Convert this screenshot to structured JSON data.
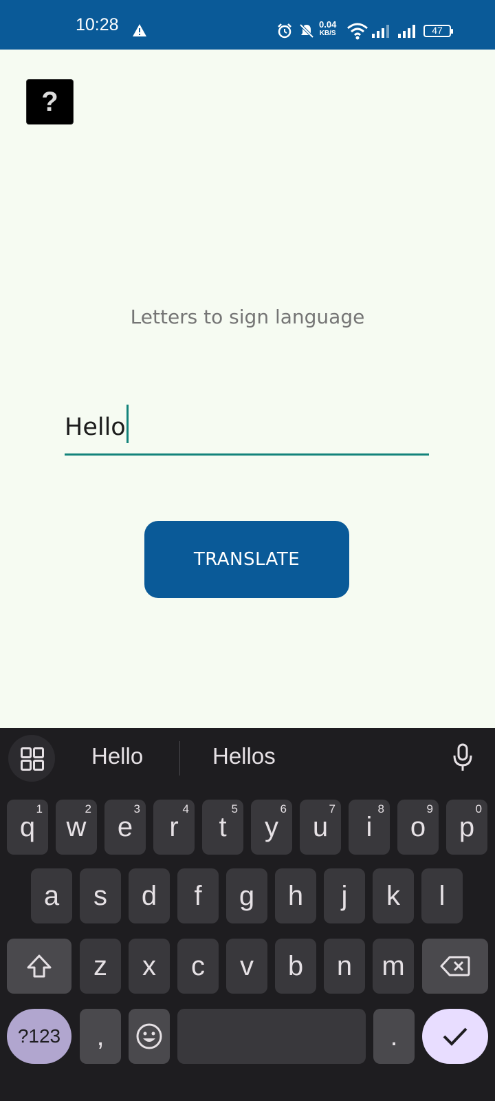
{
  "status_bar": {
    "time": "10:28",
    "net_speed_value": "0.04",
    "net_speed_unit": "KB/S",
    "battery": "47",
    "icons": [
      "warning-icon",
      "alarm-icon",
      "mute-icon",
      "wifi-icon",
      "signal-icon",
      "signal-icon",
      "battery-icon"
    ]
  },
  "app": {
    "help_label": "?",
    "subtitle": "Letters to sign language",
    "input_value": "Hello",
    "translate_label": "TRANSLATE",
    "colors": {
      "primary": "#0a5a98",
      "accent": "#13837b",
      "background": "#f6fbf2"
    }
  },
  "keyboard": {
    "suggestions": [
      "Hello",
      "Hellos"
    ],
    "row1": [
      {
        "k": "q",
        "n": "1"
      },
      {
        "k": "w",
        "n": "2"
      },
      {
        "k": "e",
        "n": "3"
      },
      {
        "k": "r",
        "n": "4"
      },
      {
        "k": "t",
        "n": "5"
      },
      {
        "k": "y",
        "n": "6"
      },
      {
        "k": "u",
        "n": "7"
      },
      {
        "k": "i",
        "n": "8"
      },
      {
        "k": "o",
        "n": "9"
      },
      {
        "k": "p",
        "n": "0"
      }
    ],
    "row2": [
      "a",
      "s",
      "d",
      "f",
      "g",
      "h",
      "j",
      "k",
      "l"
    ],
    "row3": [
      "z",
      "x",
      "c",
      "v",
      "b",
      "n",
      "m"
    ],
    "symbols_label": "?123",
    "comma": ",",
    "period": "."
  }
}
